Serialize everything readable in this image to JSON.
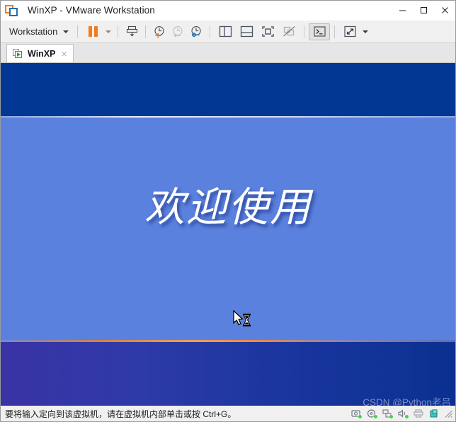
{
  "window": {
    "title": "WinXP - VMware Workstation",
    "logo_icon": "vmware-logo-icon",
    "minimize_icon": "minimize-icon",
    "maximize_icon": "maximize-icon",
    "close_icon": "close-icon"
  },
  "toolbar": {
    "workstation_menu_label": "Workstation",
    "items": [
      {
        "name": "workstation-menu",
        "label": "Workstation",
        "icon": "chevron-down-icon"
      },
      {
        "name": "suspend-button",
        "label": "Suspend",
        "icon": "pause-icon"
      },
      {
        "name": "power-dropdown",
        "label": "Power options",
        "icon": "chevron-down-icon"
      },
      {
        "name": "take-snapshot-button",
        "label": "Take a snapshot of this virtual machine",
        "icon": "snapshot-icon"
      },
      {
        "name": "take-snapshot-clock-button",
        "label": "Take snapshot",
        "icon": "clock-plus-icon"
      },
      {
        "name": "revert-snapshot-button",
        "label": "Revert to snapshot",
        "icon": "clock-revert-icon"
      },
      {
        "name": "manage-snapshots-button",
        "label": "Manage snapshots",
        "icon": "clock-wrench-icon"
      },
      {
        "name": "show-library-button",
        "label": "Show or hide the Library",
        "icon": "library-pane-icon"
      },
      {
        "name": "show-console-view-button",
        "label": "Show or hide console view",
        "icon": "bottom-pane-icon"
      },
      {
        "name": "full-screen-button",
        "label": "Enter full screen mode",
        "icon": "fullscreen-icon"
      },
      {
        "name": "unity-mode-button",
        "label": "Unity mode",
        "icon": "unity-disabled-icon"
      },
      {
        "name": "console-button",
        "label": "Console",
        "icon": "terminal-icon"
      },
      {
        "name": "stretch-button",
        "label": "Stretch guest display",
        "icon": "stretch-arrows-icon"
      },
      {
        "name": "stretch-dropdown",
        "label": "Stretch options",
        "icon": "chevron-down-icon"
      }
    ]
  },
  "tabs": [
    {
      "label": "WinXP",
      "icon": "virtual-machine-icon",
      "close_label": "×",
      "active": true
    }
  ],
  "vm_screen": {
    "welcome_text": "欢迎使用",
    "cursor_icon": "arrow-hourglass-busy-cursor",
    "colors": {
      "top_band": "#023793",
      "middle_band": "#5a81dd",
      "divider_orange": "#ef8a3e",
      "bottom_band_left": "#3a33a6",
      "bottom_band_right": "#0a3091"
    },
    "watermark": "CSDN @Python老吕"
  },
  "statusbar": {
    "message": "要将输入定向到该虚拟机，请在虚拟机内部单击或按 Ctrl+G。",
    "devices": [
      {
        "name": "hard-disk-status-icon",
        "connected": true
      },
      {
        "name": "cd-dvd-status-icon",
        "connected": true
      },
      {
        "name": "network-adapter-status-icon",
        "connected": true
      },
      {
        "name": "sound-card-status-icon",
        "connected": true
      },
      {
        "name": "printer-status-icon",
        "connected": false
      },
      {
        "name": "usb-device-status-icon",
        "connected": false
      }
    ],
    "resize_grip_icon": "resize-grip-icon"
  }
}
